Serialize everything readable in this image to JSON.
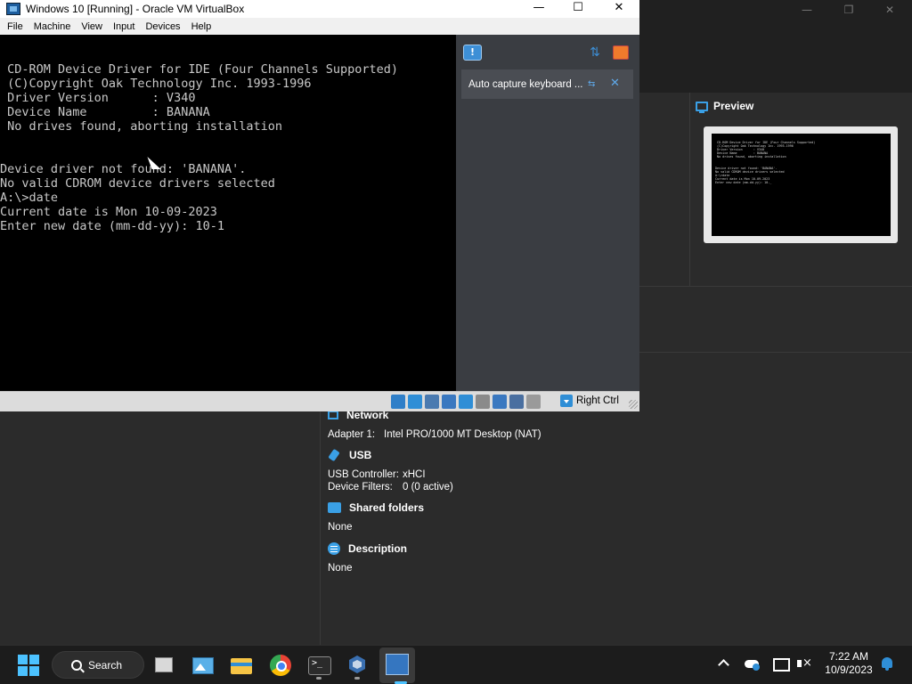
{
  "vm_window": {
    "title": "Windows 10 [Running] - Oracle VM VirtualBox",
    "controls": {
      "minimize": "—",
      "maximize": "☐",
      "close": "✕"
    },
    "menu": [
      "File",
      "Machine",
      "View",
      "Input",
      "Devices",
      "Help"
    ],
    "console_text": " CD-ROM Device Driver for IDE (Four Channels Supported)\n (C)Copyright Oak Technology Inc. 1993-1996\n Driver Version      : V340\n Device Name         : BANANA\n No drives found, aborting installation\n\n\nDevice driver not found: 'BANANA'.\nNo valid CDROM device drivers selected\nA:\\>date\nCurrent date is Mon 10-09-2023\nEnter new date (mm-dd-yy): 10-1",
    "notification": {
      "text": "Auto capture keyboard ...",
      "pin_glyph": "⇆",
      "close_glyph": "✕"
    },
    "status_bar": {
      "host_key": "Right Ctrl",
      "icons": [
        {
          "name": "hard-disk-icon",
          "color": "#2f7fc8"
        },
        {
          "name": "optical-drive-icon",
          "color": "#2f8ed6"
        },
        {
          "name": "audio-icon",
          "color": "#4a7ab0"
        },
        {
          "name": "network-icon",
          "color": "#3a78c0"
        },
        {
          "name": "usb-icon",
          "color": "#2f8ed6"
        },
        {
          "name": "shared-folders-icon",
          "color": "#8a8a8a"
        },
        {
          "name": "display-icon",
          "color": "#3a78c0"
        },
        {
          "name": "recording-icon",
          "color": "#4a6fa0"
        },
        {
          "name": "cpu-icon",
          "color": "#9a9a9a"
        }
      ]
    }
  },
  "manager": {
    "controls": {
      "minimize": "—",
      "maximize": "❐",
      "close": "✕"
    },
    "preview": {
      "title": "Preview",
      "thumb_text": " CD-ROM Device Driver for IDE (Four Channels Supported)\n (C)Copyright Oak Technology Inc. 1993-1996\n Driver Version      : V340\n Device Name         : BANANA\n No drives found, aborting installation\n\n\nDevice driver not found: 'BANANA'.\nNo valid CDROM device drivers selected\nA:\\>date\nCurrent date is Mon 10-09-2023\nEnter new date (mm-dd-yy): 10-_"
    },
    "details": {
      "network": {
        "title": "Network",
        "adapter_key": "Adapter 1:",
        "adapter_value": "Intel PRO/1000 MT Desktop (NAT)"
      },
      "usb": {
        "title": "USB",
        "controller_key": "USB Controller:",
        "controller_value": "xHCI",
        "filters_key": "Device Filters:",
        "filters_value": "0 (0 active)"
      },
      "shared_folders": {
        "title": "Shared folders",
        "value": "None"
      },
      "description": {
        "title": "Description",
        "value": "None"
      }
    }
  },
  "taskbar": {
    "search_label": "Search",
    "clock_time": "7:22 AM",
    "clock_date": "10/9/2023"
  }
}
